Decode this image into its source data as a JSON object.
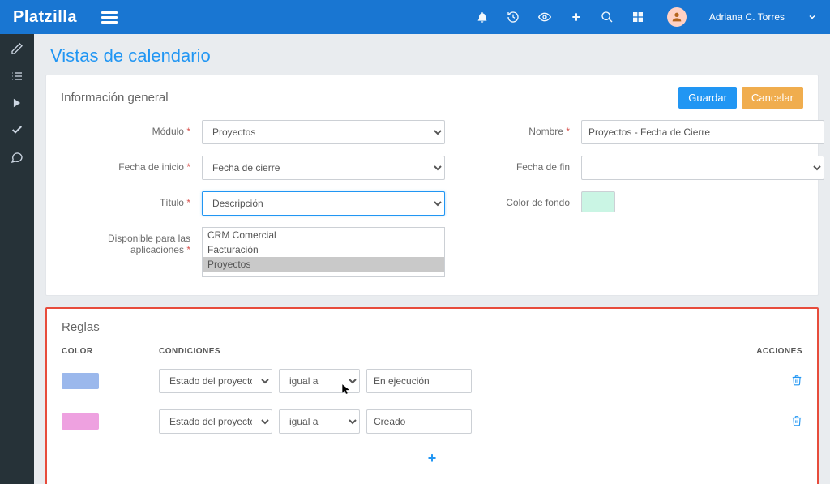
{
  "brand": "Platzilla",
  "user": {
    "name": "Adriana C. Torres"
  },
  "page_title": "Vistas de calendario",
  "general": {
    "title": "Información general",
    "save": "Guardar",
    "cancel": "Cancelar",
    "labels": {
      "module": "Módulo",
      "name": "Nombre",
      "start_date": "Fecha de inicio",
      "end_date": "Fecha de fin",
      "title_field": "Título",
      "bgcolor": "Color de fondo",
      "apps": "Disponible para las aplicaciones"
    },
    "values": {
      "module": "Proyectos",
      "name": "Proyectos - Fecha de Cierre",
      "start_date": "Fecha de cierre",
      "end_date": "",
      "title_field": "Descripción",
      "bg_swatch": "#caf5e4",
      "apps": [
        "CRM Comercial",
        "Facturación",
        "Proyectos"
      ],
      "apps_selected": "Proyectos"
    }
  },
  "rules": {
    "title": "Reglas",
    "headers": {
      "color": "COLOR",
      "cond": "CONDICIONES",
      "act": "ACCIONES"
    },
    "rows": [
      {
        "color": "#9bb8ec",
        "field": "Estado del proyecto",
        "op": "igual a",
        "value": "En ejecución"
      },
      {
        "color": "#eea1e0",
        "field": "Estado del proyecto",
        "op": "igual a",
        "value": "Creado"
      }
    ]
  }
}
